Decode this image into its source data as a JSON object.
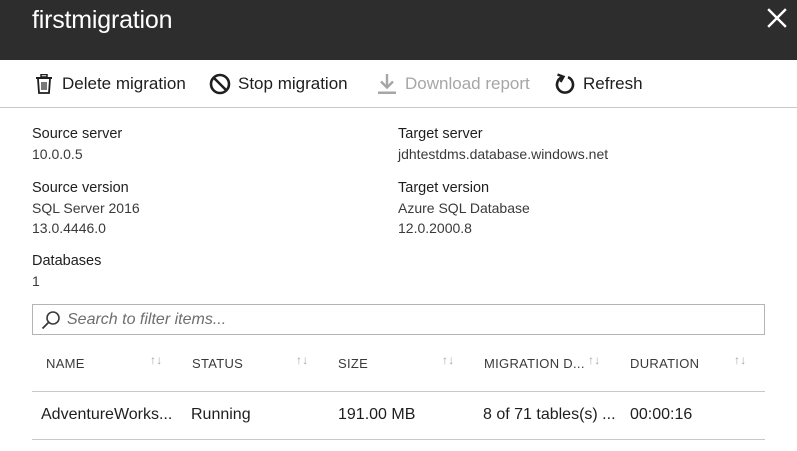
{
  "header": {
    "title": "firstmigration"
  },
  "toolbar": {
    "delete_label": "Delete migration",
    "stop_label": "Stop migration",
    "download_label": "Download report",
    "refresh_label": "Refresh"
  },
  "details": {
    "source_server": {
      "label": "Source server",
      "value": "10.0.0.5"
    },
    "target_server": {
      "label": "Target server",
      "value": "jdhtestdms.database.windows.net"
    },
    "source_version": {
      "label": "Source version",
      "line1": "SQL Server 2016",
      "line2": "13.0.4446.0"
    },
    "target_version": {
      "label": "Target version",
      "line1": "Azure SQL Database",
      "line2": "12.0.2000.8"
    },
    "databases": {
      "label": "Databases",
      "value": "1"
    }
  },
  "search": {
    "placeholder": "Search to filter items..."
  },
  "table": {
    "columns": [
      "NAME",
      "STATUS",
      "SIZE",
      "MIGRATION D...",
      "DURATION"
    ],
    "rows": [
      [
        "AdventureWorks...",
        "Running",
        "191.00 MB",
        "8 of 71 tables(s) ...",
        "00:00:16"
      ]
    ]
  },
  "colors": {
    "header_bg": "#2d2d2d",
    "disabled_text": "#a6a6a6"
  }
}
